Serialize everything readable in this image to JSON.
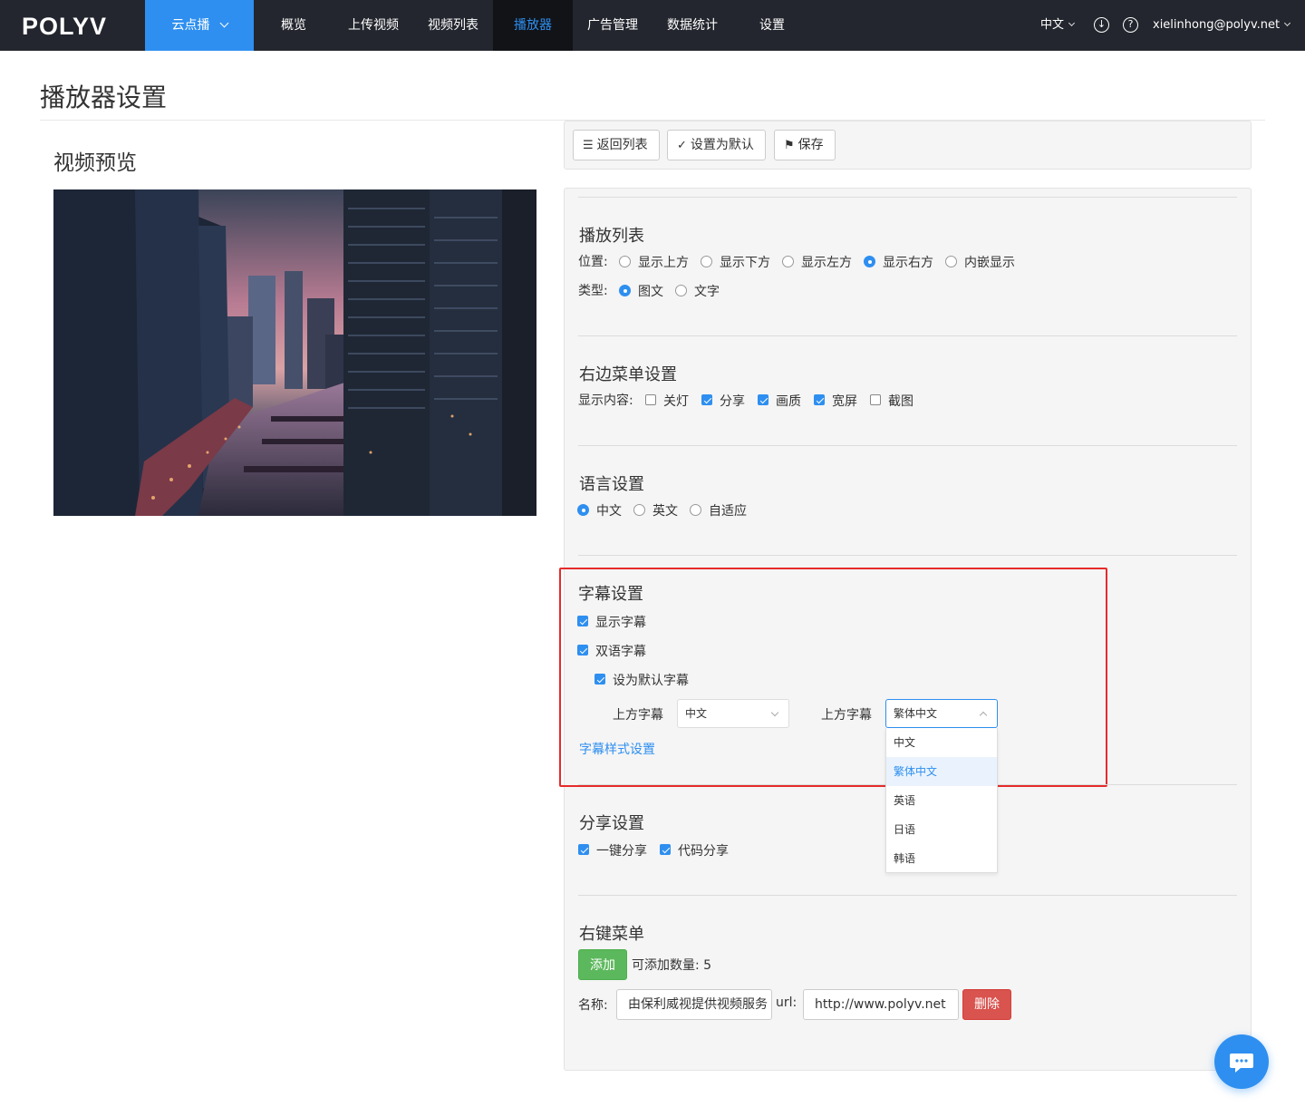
{
  "nav": {
    "brand": "POLYV",
    "product": "云点播",
    "items": [
      "概览",
      "上传视频",
      "视频列表",
      "播放器",
      "广告管理",
      "数据统计",
      "设置"
    ],
    "active_item": "播放器",
    "language": "中文",
    "user": "xielinhong@polyv.net"
  },
  "page": {
    "title": "播放器设置",
    "preview_title": "视频预览"
  },
  "toolbar": {
    "back": "返回列表",
    "set_default": "设置为默认",
    "save": "保存"
  },
  "playlist": {
    "title": "播放列表",
    "position_label": "位置:",
    "positions": [
      "显示上方",
      "显示下方",
      "显示左方",
      "显示右方",
      "内嵌显示"
    ],
    "position_selected": "显示右方",
    "type_label": "类型:",
    "types": [
      "图文",
      "文字"
    ],
    "type_selected": "图文"
  },
  "right_menu": {
    "title": "右边菜单设置",
    "content_label": "显示内容:",
    "items": [
      {
        "label": "关灯",
        "checked": false
      },
      {
        "label": "分享",
        "checked": true
      },
      {
        "label": "画质",
        "checked": true
      },
      {
        "label": "宽屏",
        "checked": true
      },
      {
        "label": "截图",
        "checked": false
      }
    ]
  },
  "language": {
    "title": "语言设置",
    "options": [
      "中文",
      "英文",
      "自适应"
    ],
    "selected": "中文"
  },
  "subtitle": {
    "title": "字幕设置",
    "show": {
      "label": "显示字幕",
      "checked": true
    },
    "bilingual": {
      "label": "双语字幕",
      "checked": true
    },
    "set_default": {
      "label": "设为默认字幕",
      "checked": true
    },
    "upper_label_1": "上方字幕",
    "upper_value_1": "中文",
    "upper_label_2": "上方字幕",
    "upper_value_2": "繁体中文",
    "dropdown_options": [
      "中文",
      "繁体中文",
      "英语",
      "日语",
      "韩语"
    ],
    "dropdown_selected": "繁体中文",
    "style_link": "字幕样式设置"
  },
  "share": {
    "title": "分享设置",
    "items": [
      {
        "label": "一键分享",
        "checked": true
      },
      {
        "label": "代码分享",
        "checked": true
      }
    ]
  },
  "context_menu": {
    "title": "右键菜单",
    "add": "添加",
    "remaining_label": "可添加数量:",
    "remaining": "5",
    "name_label": "名称:",
    "name_value": "由保利威视提供视频服务",
    "url_label": "url:",
    "url_value": "http://www.polyv.net",
    "delete": "删除"
  },
  "colors": {
    "accent": "#2e8ff0",
    "nav_bg": "#23262e",
    "success": "#5cb85c",
    "danger": "#d9534f",
    "highlight": "#e62b2b"
  }
}
